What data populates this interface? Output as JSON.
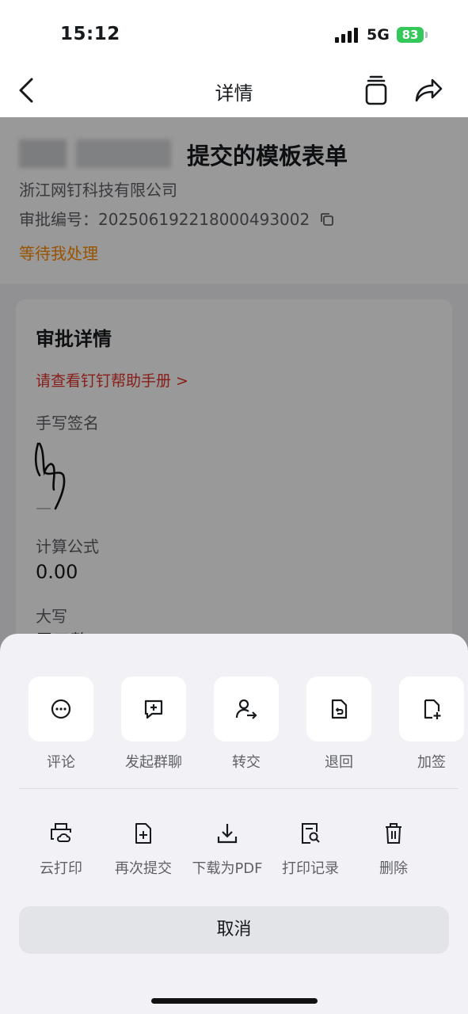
{
  "status_bar": {
    "time": "15:12",
    "network": "5G",
    "battery": "83"
  },
  "nav": {
    "title": "详情"
  },
  "header": {
    "form_title": "提交的模板表单",
    "company": "浙江网钉科技有限公司",
    "approval_no_label": "审批编号：",
    "approval_no": "202506192218000493002",
    "status": "等待我处理"
  },
  "detail": {
    "heading": "审批详情",
    "help_link": "请查看钉钉帮助手册 >",
    "signature_label": "手写签名",
    "formula_label": "计算公式",
    "formula_value": "0.00",
    "daxie_label": "大写",
    "daxie_value": "零元整"
  },
  "sheet": {
    "top_actions": [
      {
        "label": "评论",
        "icon": "comment-icon"
      },
      {
        "label": "发起群聊",
        "icon": "group-chat-icon"
      },
      {
        "label": "转交",
        "icon": "transfer-icon"
      },
      {
        "label": "退回",
        "icon": "return-icon"
      },
      {
        "label": "加签",
        "icon": "add-sign-icon"
      }
    ],
    "bottom_actions": [
      {
        "label": "云打印",
        "icon": "cloud-print-icon"
      },
      {
        "label": "再次提交",
        "icon": "resubmit-icon"
      },
      {
        "label": "下载为PDF",
        "icon": "download-icon"
      },
      {
        "label": "打印记录",
        "icon": "print-record-icon"
      },
      {
        "label": "删除",
        "icon": "trash-icon"
      }
    ],
    "cancel": "取消"
  },
  "colors": {
    "accent_orange": "#ff8a00",
    "link_red": "#e3322b",
    "battery_green": "#34c759"
  }
}
